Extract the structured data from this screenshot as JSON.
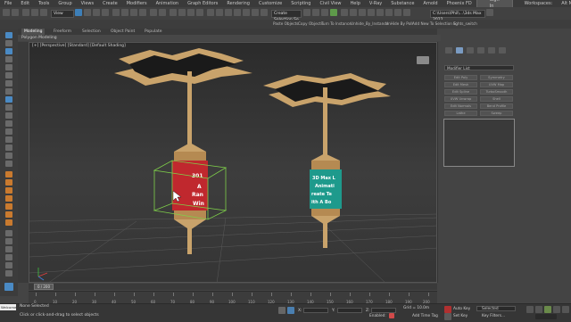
{
  "menu": {
    "items": [
      "File",
      "Edit",
      "Tools",
      "Group",
      "Views",
      "Create",
      "Modifiers",
      "Animation",
      "Graph Editors",
      "Rendering",
      "Customize",
      "Scripting",
      "Civil View",
      "Help",
      "V-Ray",
      "Substance",
      "Arnold",
      "Phoenix FD"
    ],
    "sign_in": "Sign In",
    "workspaces_label": "Workspaces:",
    "workspace_value": "Alt Menu and..."
  },
  "toolbar": {
    "layer_dropdown": "View",
    "selection_set": "Create Selection Se",
    "path_value": "C:\\Users\\Phil\\...\\3ds Max 2022"
  },
  "toolbar2": {
    "items": [
      "Paste Objects",
      "Copy Objects",
      "Turn To Instance",
      "Unhide_By_Instance",
      "UnHide By Poll",
      "Add New To Selection S",
      "lights_switch"
    ]
  },
  "ribbon": {
    "tabs": [
      "Modeling",
      "Freeform",
      "Selection",
      "Object Paint",
      "Populate"
    ],
    "active_tab": "Modeling",
    "sub": "Polygon Modeling"
  },
  "viewport": {
    "label": "[+] [Perspective] [Standard] [Default Shading]",
    "left_lantern_text": [
      "301",
      "A",
      "Ran",
      "Win"
    ],
    "right_lantern_text": [
      "3D Max L",
      "Animati",
      "reate Te",
      "ith A Bo"
    ]
  },
  "command_panel": {
    "modifier_list": "Modifier List",
    "modifier_buttons": [
      "Edit Poly",
      "Edit Mesh",
      "Edit Spline",
      "UVW Unwrap",
      "Edit Normals",
      "Lathe",
      "Symmetry",
      "UVW Map",
      "TurboSmooth",
      "Shell",
      "Bend Profile",
      "Sweep",
      "Extrude",
      "FFD 4x4x4"
    ]
  },
  "timeline": {
    "frame_display": "0 / 200",
    "ticks": [
      "0",
      "10",
      "20",
      "30",
      "40",
      "50",
      "60",
      "70",
      "80",
      "90",
      "100",
      "110",
      "120",
      "130",
      "140",
      "150",
      "160",
      "170",
      "180",
      "190",
      "200"
    ]
  },
  "status": {
    "maxscript": "Welcome to M",
    "selection": "None Selected",
    "prompt": "Click or click-and-drag to select objects",
    "x": "X:",
    "y": "Y:",
    "z": "Z:",
    "grid": "Grid = 10.0m",
    "add_time_tag": "Add Time Tag",
    "enabled": "Enabled:",
    "auto_key": "Auto Key",
    "set_key": "Set Key",
    "selected": "Selected",
    "key_filters": "Key Filters..."
  },
  "colors": {
    "accent": "#3d7fb8",
    "lantern_red": "#c0282e",
    "lantern_teal": "#1e9a8c",
    "umbrella": "#c9a36b",
    "selection_box": "#7fd04a"
  }
}
